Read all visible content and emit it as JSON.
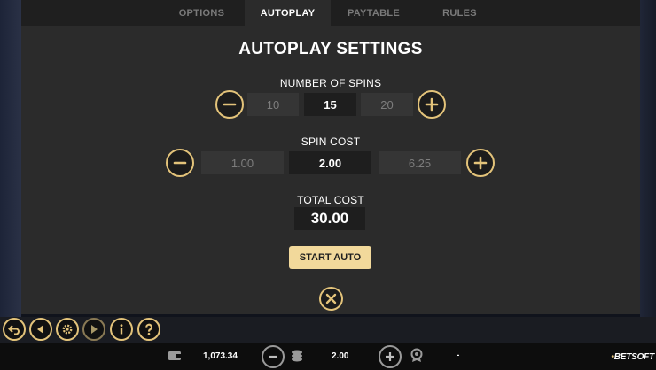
{
  "tabs": [
    {
      "label": "OPTIONS",
      "active": false
    },
    {
      "label": "AUTOPLAY",
      "active": true
    },
    {
      "label": "PAYTABLE",
      "active": false
    },
    {
      "label": "RULES",
      "active": false
    }
  ],
  "title": "AUTOPLAY SETTINGS",
  "spins": {
    "label": "NUMBER OF SPINS",
    "options": [
      "10",
      "15",
      "20"
    ],
    "selected": "15"
  },
  "spin_cost": {
    "label": "SPIN COST",
    "options": [
      "1.00",
      "2.00",
      "6.25"
    ],
    "selected": "2.00"
  },
  "total_cost": {
    "label": "TOTAL COST",
    "value": "30.00"
  },
  "start_button": "START AUTO",
  "controls": [
    {
      "name": "back-arrow-icon"
    },
    {
      "name": "previous-icon"
    },
    {
      "name": "gear-icon"
    },
    {
      "name": "next-icon"
    },
    {
      "name": "info-icon"
    },
    {
      "name": "help-icon"
    }
  ],
  "bottom_bar": {
    "balance": "1,073.34",
    "bet": "2.00",
    "win": "-",
    "logo": "BETSOFT"
  },
  "colors": {
    "accent_gold": "#e3c37a",
    "start_button_bg": "#f2d99b",
    "panel_bg": "#2b2b2b"
  }
}
